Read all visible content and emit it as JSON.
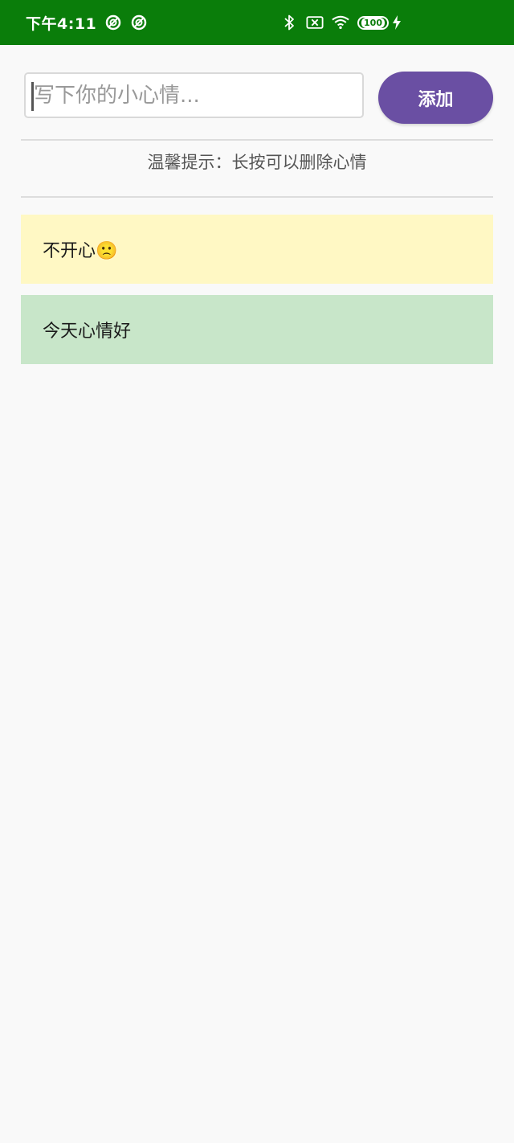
{
  "status_bar": {
    "time": "下午4:11",
    "battery": "100",
    "background_color": "#0a7d0a",
    "icons": [
      "app-notification-icon",
      "app-notification-icon",
      "bluetooth-icon",
      "sim-off-icon",
      "wifi-icon",
      "battery-icon",
      "charging-icon"
    ]
  },
  "input": {
    "placeholder": "写下你的小心情...",
    "value": ""
  },
  "add_button": {
    "label": "添加",
    "color": "#6a4fa3"
  },
  "hint": "温馨提示：长按可以删除心情",
  "moods": [
    {
      "text": "不开心🙁",
      "color": "#fff8c4"
    },
    {
      "text": "今天心情好",
      "color": "#c8e6c9"
    }
  ]
}
